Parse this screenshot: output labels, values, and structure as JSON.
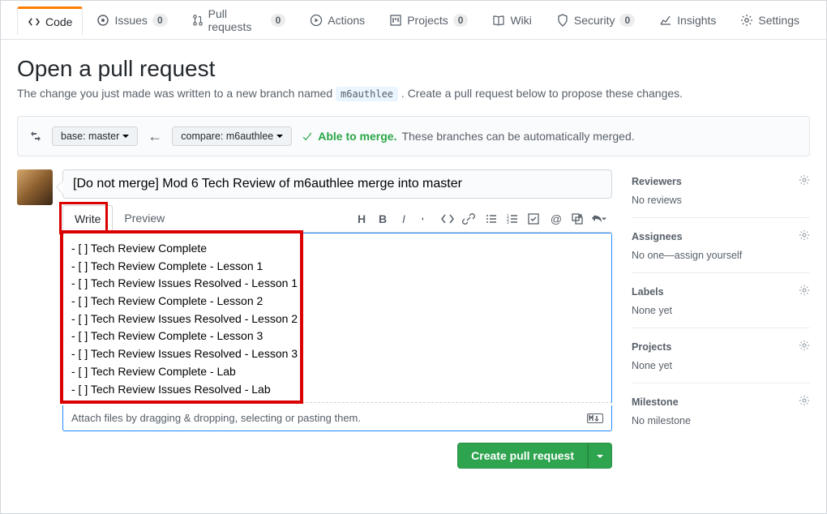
{
  "nav": {
    "code": "Code",
    "issues": "Issues",
    "issues_count": "0",
    "pulls": "Pull requests",
    "pulls_count": "0",
    "actions": "Actions",
    "projects": "Projects",
    "projects_count": "0",
    "wiki": "Wiki",
    "security": "Security",
    "security_count": "0",
    "insights": "Insights",
    "settings": "Settings"
  },
  "page": {
    "title": "Open a pull request",
    "subtitle_a": "The change you just made was written to a new branch named ",
    "branch": "m6authlee",
    "subtitle_b": " . Create a pull request below to propose these changes."
  },
  "range": {
    "base_label": "base: master",
    "compare_label": "compare: m6authlee",
    "merge_ok": "Able to merge.",
    "merge_desc": "These branches can be automatically merged."
  },
  "form": {
    "title_value": "[Do not merge] Mod 6 Tech Review of m6authlee merge into master",
    "write_tab": "Write",
    "preview_tab": "Preview",
    "body": "- [ ] Tech Review Complete\n- [ ] Tech Review Complete - Lesson 1\n- [ ] Tech Review Issues Resolved - Lesson 1\n- [ ] Tech Review Complete - Lesson 2\n- [ ] Tech Review Issues Resolved - Lesson 2\n- [ ] Tech Review Complete - Lesson 3\n- [ ] Tech Review Issues Resolved - Lesson 3\n- [ ] Tech Review Complete - Lab\n- [ ] Tech Review Issues Resolved - Lab",
    "attach": "Attach files by dragging & dropping, selecting or pasting them.",
    "submit": "Create pull request"
  },
  "sidebar": {
    "reviewers": {
      "title": "Reviewers",
      "value": "No reviews"
    },
    "assignees": {
      "title": "Assignees",
      "value": "No one—assign yourself"
    },
    "labels": {
      "title": "Labels",
      "value": "None yet"
    },
    "projects": {
      "title": "Projects",
      "value": "None yet"
    },
    "milestone": {
      "title": "Milestone",
      "value": "No milestone"
    }
  }
}
